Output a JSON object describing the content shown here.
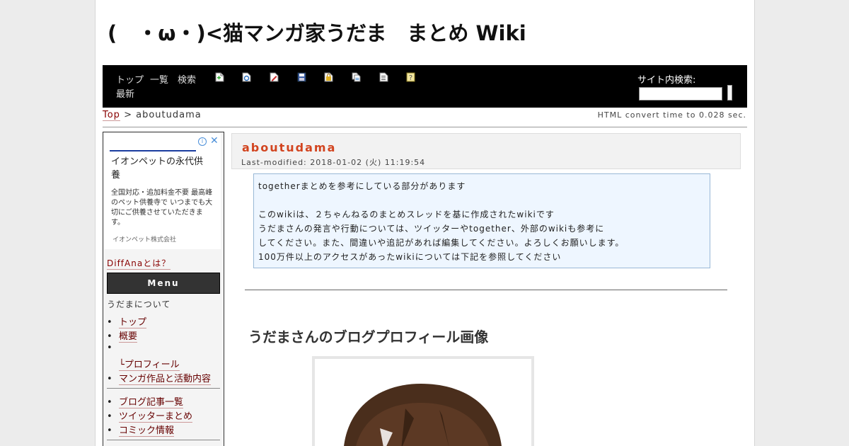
{
  "site": {
    "title": "(　・ω・)<猫マンガ家うだま　まとめ Wiki"
  },
  "nav": {
    "links": [
      "トップ",
      "一覧",
      "検索",
      "最新"
    ],
    "icons": [
      "new-page-icon",
      "reload-icon",
      "edit-icon",
      "save-icon",
      "freeze-icon",
      "copy-icon",
      "list-icon",
      "help-icon"
    ],
    "search_label": "サイト内検索:",
    "search_value": "",
    "search_button": ""
  },
  "breadcrumb": {
    "top": "Top",
    "separator": " > ",
    "current": "aboutudama"
  },
  "convert_time": "HTML convert time to 0.028 sec.",
  "sidebar": {
    "ad": {
      "title": "イオンペットの永代供養",
      "body": "全国対応・追加料金不要 最高峰のペット供養寺で いつまでも大切にご供養させていただきます。",
      "sponsor": "イオンペット株式会社"
    },
    "diffana": "DiffAnaとは？",
    "menu_label": "Menu",
    "heading": "うだまについて",
    "group1": [
      {
        "label": "トップ",
        "linked": true
      },
      {
        "label": "概要",
        "linked": true
      },
      {
        "label": "",
        "linked": false
      },
      {
        "label": "└プロフィール",
        "linked": true
      },
      {
        "label": "マンガ作品と活動内容",
        "linked": true
      }
    ],
    "group2": [
      {
        "label": "ブログ記事一覧",
        "linked": true
      },
      {
        "label": "ツイッターまとめ",
        "linked": true
      },
      {
        "label": "コミック情報",
        "linked": true
      }
    ]
  },
  "page": {
    "title": "aboutudama",
    "last_modified": "Last-modified: 2018-01-02 (火) 11:19:54",
    "notice_lines": [
      "togetherまとめを参考にしている部分があります",
      "",
      "このwikiは、２ちゃんねるのまとめスレッドを基に作成されたwikiです",
      "うだまさんの発言や行動については、ツイッターやtogether、外部のwikiも参考に",
      "してください。また、間違いや追記があれば編集してください。よろしくお願いします。",
      "100万件以上のアクセスがあったwikiについては下記を参照してください"
    ],
    "section_heading": "うだまさんのブログプロフィール画像"
  },
  "colors": {
    "navbar": "#000000",
    "page_title": "#d2441f",
    "link": "#880000",
    "notice_bg": "#eef6ff",
    "notice_border": "#99b8d6",
    "menu_bar": "#333333",
    "ad_accent": "#1a3c9f"
  }
}
